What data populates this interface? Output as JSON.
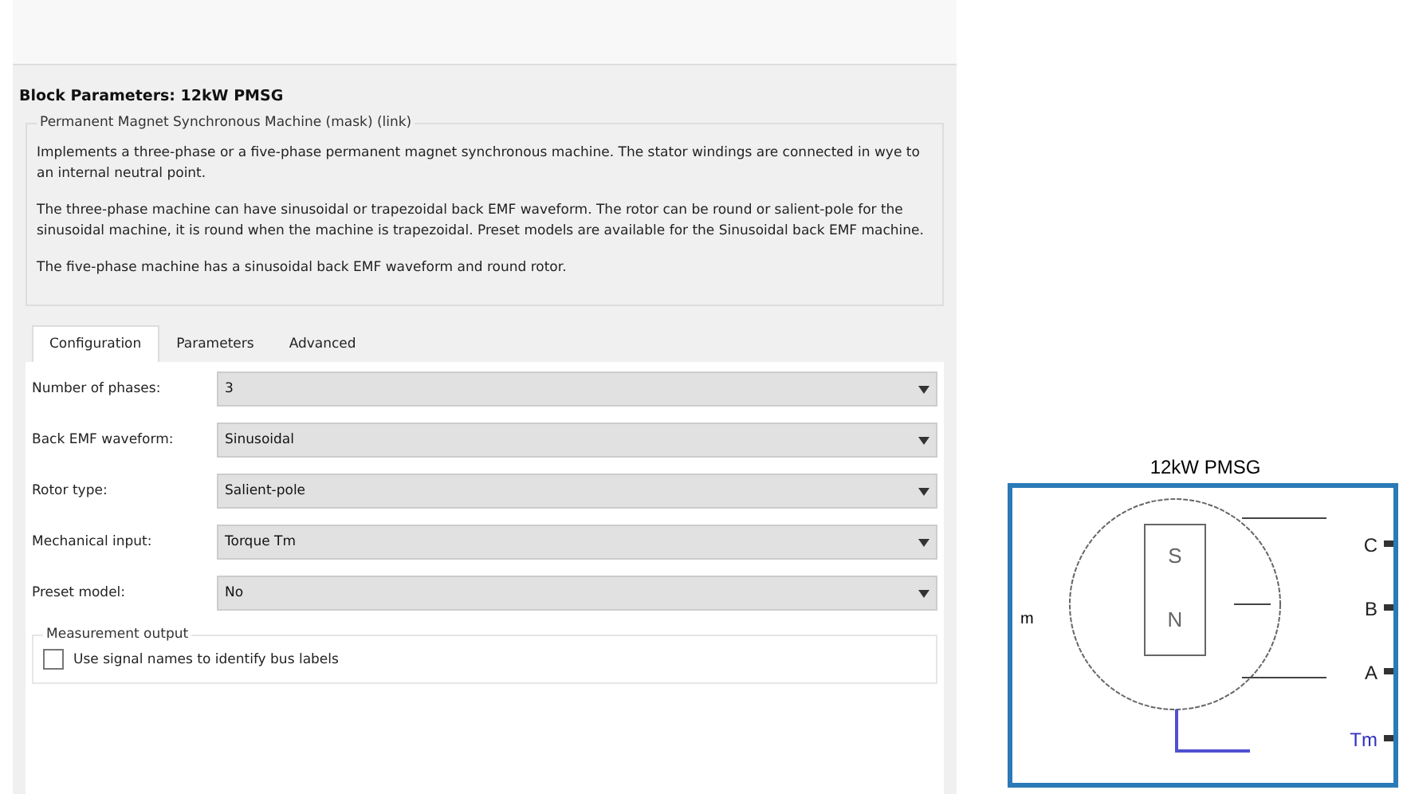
{
  "dialog": {
    "title": "Block Parameters: 12kW PMSG",
    "description": {
      "legend": "Permanent Magnet Synchronous Machine (mask) (link)",
      "paragraphs": [
        "Implements a three-phase or a five-phase permanent magnet synchronous machine. The stator windings are connected in wye to an internal neutral point.",
        "The three-phase machine can have sinusoidal or trapezoidal back EMF waveform. The rotor can be round or salient-pole for the sinusoidal machine, it is round when the machine is trapezoidal. Preset models are available for the Sinusoidal back EMF machine.",
        "The five-phase machine has a sinusoidal back EMF waveform and round rotor."
      ]
    },
    "tabs": [
      {
        "label": "Configuration",
        "selected": true
      },
      {
        "label": "Parameters",
        "selected": false
      },
      {
        "label": "Advanced",
        "selected": false
      }
    ],
    "params": [
      {
        "label": "Number of phases:",
        "value": "3"
      },
      {
        "label": "Back EMF waveform:",
        "value": "Sinusoidal"
      },
      {
        "label": "Rotor type:",
        "value": "Salient-pole"
      },
      {
        "label": "Mechanical input:",
        "value": "Torque Tm"
      },
      {
        "label": "Preset model:",
        "value": "No"
      }
    ],
    "measurement": {
      "legend": "Measurement output",
      "checkbox": {
        "label": "Use signal names to identify bus labels",
        "checked": false
      }
    }
  },
  "block": {
    "title": "12kW PMSG",
    "left_port": "m",
    "right_ports": [
      "C",
      "B",
      "A",
      "Tm"
    ],
    "poles": [
      "S",
      "N"
    ]
  }
}
